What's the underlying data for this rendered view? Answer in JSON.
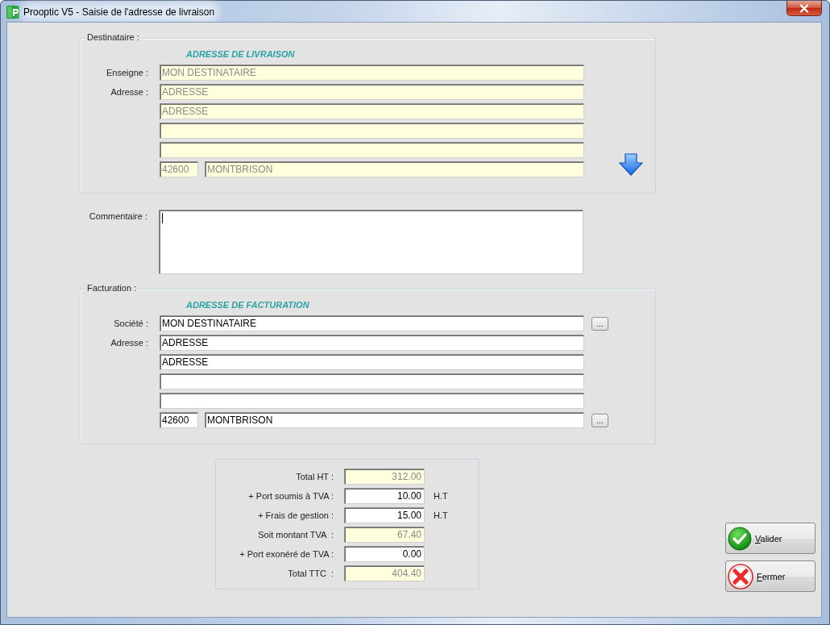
{
  "window": {
    "title": "Prooptic V5 - Saisie de l'adresse de livraison"
  },
  "delivery": {
    "legend": "Destinataire :",
    "heading": "ADRESSE DE LIVRAISON",
    "rows": [
      {
        "label": "Enseigne :",
        "fields": [
          {
            "kind": "line",
            "value": "MON DESTINATAIRE",
            "readonly": true
          }
        ]
      },
      {
        "label": "Adresse :",
        "fields": [
          {
            "kind": "line",
            "value": "ADRESSE",
            "readonly": true
          }
        ]
      },
      {
        "fields": [
          {
            "kind": "line",
            "value": "ADRESSE",
            "readonly": true
          }
        ]
      },
      {
        "fields": [
          {
            "kind": "line",
            "readonly": true
          }
        ]
      },
      {
        "fields": [
          {
            "kind": "line",
            "readonly": true
          }
        ]
      },
      {
        "fields": [
          {
            "kind": "postcode",
            "value": "42600",
            "readonly": true
          },
          {
            "kind": "city",
            "value": "MONTBRISON",
            "readonly": true
          }
        ]
      }
    ]
  },
  "comment": {
    "label": "Commentaire :",
    "focused": true
  },
  "billing": {
    "legend": "Facturation :",
    "heading": "ADRESSE DE FACTURATION",
    "rows": [
      {
        "label": "Société :",
        "picker": "...",
        "fields": [
          {
            "kind": "line",
            "value": "MON DESTINATAIRE",
            "readonly": false
          }
        ]
      },
      {
        "label": "Adresse :",
        "fields": [
          {
            "kind": "line",
            "value": "ADRESSE",
            "readonly": false
          }
        ]
      },
      {
        "fields": [
          {
            "kind": "line",
            "value": "ADRESSE",
            "readonly": false
          }
        ]
      },
      {
        "fields": [
          {
            "kind": "line",
            "readonly": false
          }
        ]
      },
      {
        "fields": [
          {
            "kind": "line",
            "readonly": false
          }
        ]
      },
      {
        "picker": "...",
        "fields": [
          {
            "kind": "postcode",
            "value": "42600",
            "readonly": false
          },
          {
            "kind": "city",
            "value": "MONTBRISON",
            "readonly": false
          }
        ]
      }
    ]
  },
  "totals": [
    {
      "label": "Total HT :",
      "value": "312.00",
      "readonly": true
    },
    {
      "label": "+ Port soumis à TVA :",
      "value": "10.00",
      "readonly": false,
      "unit": "H.T"
    },
    {
      "label": "+ Frais de gestion :",
      "value": "15.00",
      "readonly": false,
      "unit": "H.T"
    },
    {
      "label": "Soit montant TVA  :",
      "value": "67.40",
      "readonly": true
    },
    {
      "label": "+ Port exonéré de TVA :",
      "value": "0.00",
      "readonly": false
    },
    {
      "label": "Total TTC  :",
      "value": "404.40",
      "readonly": true
    }
  ],
  "buttons": [
    {
      "label": "Valider",
      "kind": "confirm"
    },
    {
      "label": "Fermer",
      "kind": "cancel"
    }
  ]
}
